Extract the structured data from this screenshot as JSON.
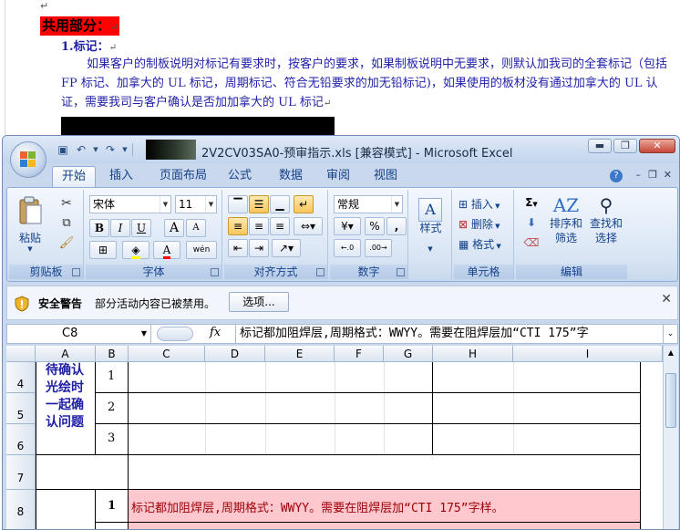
{
  "doc": {
    "heading": "共用部分：",
    "sub": "1.标记：",
    "para": "如果客户的制板说明对标记有要求时，按客户的要求，如果制板说明中无要求，则默认加我司的全套标记（包括 FP 标记、加拿大的 UL 标记，周期标记、符合无铅要求的加无铅标记)，如果使用的板材没有通过加拿大的 UL 认证，需要我司与客户确认是否加加拿大的 UL 标记",
    "para_mark": "↵",
    "line_mark": "↵"
  },
  "excel": {
    "title": "2V2CV03SA0-预审指示.xls  [兼容模式] - Microsoft Excel",
    "tabs": [
      "开始",
      "插入",
      "页面布局",
      "公式",
      "数据",
      "审阅",
      "视图"
    ],
    "ribbon": {
      "clipboard": {
        "label": "剪贴板",
        "paste": "粘贴"
      },
      "font": {
        "label": "字体",
        "name": "宋体",
        "size": "11",
        "bold": "B",
        "italic": "I",
        "underline": "U",
        "grow": "A",
        "shrink": "A",
        "fontcolor": "A",
        "wen": "wén"
      },
      "alignment": {
        "label": "对齐方式"
      },
      "number": {
        "label": "数字",
        "format": "常规",
        "percent": "%",
        "comma": ","
      },
      "styles": {
        "label": "样式"
      },
      "cells": {
        "label": "单元格",
        "insert": "插入",
        "delete": "删除",
        "format": "格式"
      },
      "editing": {
        "label": "编辑",
        "sigma": "Σ",
        "sort": "排序和\n筛选",
        "find": "查找和\n选择"
      }
    },
    "security": {
      "label": "安全警告",
      "message": "部分活动内容已被禁用。",
      "options": "选项..."
    },
    "formula_bar": {
      "name_box": "C8",
      "fx": "fx",
      "content": "标记都加阻焊层,周期格式：WWYY。需要在阻焊层加“CTI 175”字"
    },
    "columns": [
      "A",
      "B",
      "C",
      "D",
      "E",
      "F",
      "G",
      "H",
      "I"
    ],
    "rows": [
      "4",
      "5",
      "6",
      "7",
      "8"
    ],
    "cells": {
      "a4_merged": "待确认光绘时一起确认问题",
      "b4": "1",
      "b5": "2",
      "b6": "3",
      "b8": "1",
      "c8": "标记都加阻焊层,周期格式：WWYY。需要在阻焊层加“CTI 175”字样。"
    },
    "colors": {
      "highlight": "#ffc7ce",
      "heading_bg": "#ff0000",
      "text_blue": "#1f1fa8"
    }
  }
}
